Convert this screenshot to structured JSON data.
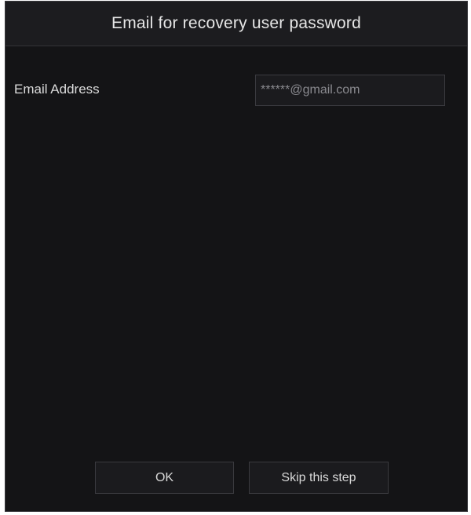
{
  "dialog": {
    "title": "Email for recovery user password",
    "email_label": "Email Address",
    "email_value": "******@gmail.com",
    "ok_label": "OK",
    "skip_label": "Skip this step"
  },
  "colors": {
    "background": "#141416",
    "titlebar": "#1c1c1f",
    "text": "#e6e6e6",
    "input_text": "#8a8a8f",
    "border": "#3a3a3e"
  }
}
